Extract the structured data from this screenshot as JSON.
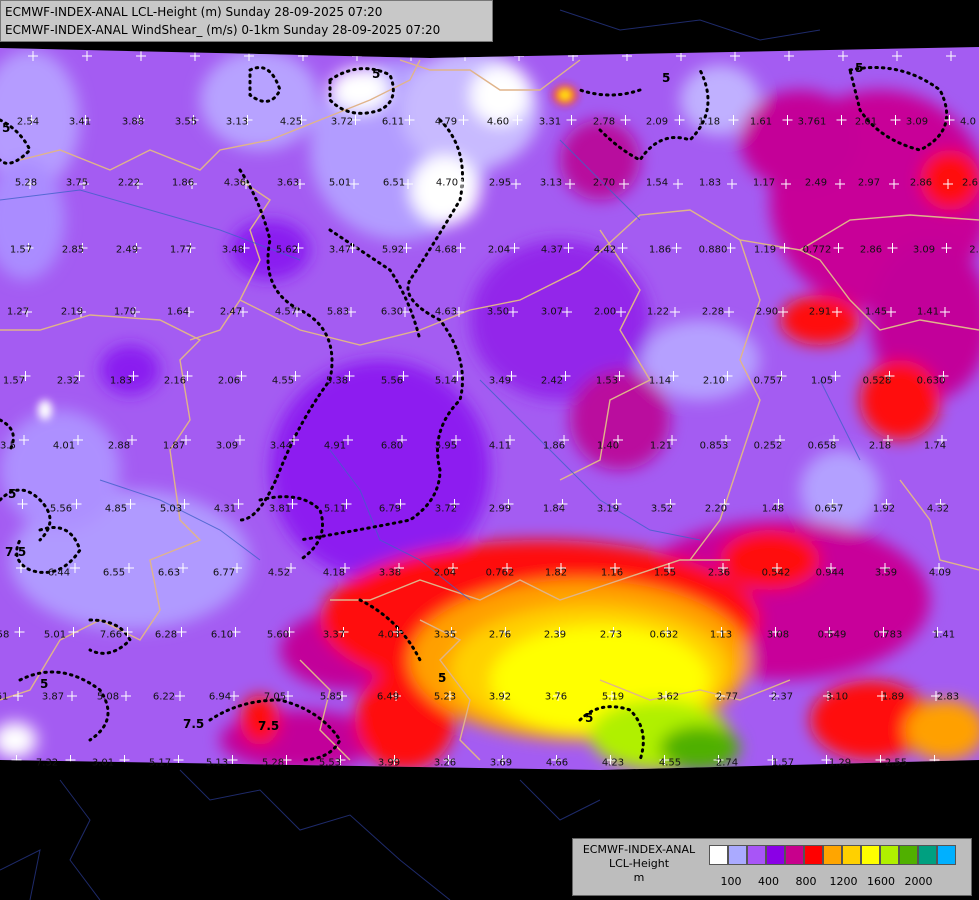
{
  "header": {
    "line1": "ECMWF-INDEX-ANAL LCL-Height (m) Sunday 28-09-2025 07:20",
    "line2": "ECMWF-INDEX-ANAL WindShear_ (m/s) 0-1km Sunday 28-09-2025 07:20"
  },
  "legend": {
    "title_line1": "ECMWF-INDEX-ANAL",
    "title_line2": "LCL-Height",
    "title_line3": "m",
    "colors": [
      "#ffffff",
      "#aaaaff",
      "#a855f7",
      "#8a00e6",
      "#c8008c",
      "#ff0000",
      "#ffa500",
      "#ffd000",
      "#ffff00",
      "#b0f000",
      "#50b000",
      "#00a080",
      "#00b0ff"
    ],
    "ticks": [
      "100",
      "400",
      "800",
      "1200",
      "1600",
      "2000"
    ]
  },
  "contour_labels": [
    "5",
    "5",
    "5",
    "5",
    "5",
    "7.5",
    "7.5",
    "7.5",
    "5",
    "5",
    "5"
  ],
  "values": [
    {
      "t": "2.54"
    },
    {
      "t": "3.41"
    },
    {
      "t": "3.88"
    },
    {
      "t": "3.55"
    },
    {
      "t": "3.13"
    },
    {
      "t": "4.25"
    },
    {
      "t": "3.72"
    },
    {
      "t": "6.11"
    },
    {
      "t": "4.79"
    },
    {
      "t": "4.60"
    },
    {
      "t": "3.31"
    },
    {
      "t": "2.78"
    },
    {
      "t": "2.09"
    },
    {
      "t": "1.18"
    },
    {
      "t": "1.61"
    },
    {
      "t": "3.761"
    },
    {
      "t": "2.61"
    },
    {
      "t": "3.09"
    },
    {
      "t": "4.0"
    },
    {
      "t": "5.28"
    },
    {
      "t": "3.75"
    },
    {
      "t": "2.22"
    },
    {
      "t": "1.86"
    },
    {
      "t": "4.36"
    },
    {
      "t": "3.63"
    },
    {
      "t": "5.01"
    },
    {
      "t": "6.51"
    },
    {
      "t": "4.70"
    },
    {
      "t": "2.95"
    },
    {
      "t": "3.13"
    },
    {
      "t": "2.70"
    },
    {
      "t": "1.54"
    },
    {
      "t": "1.83"
    },
    {
      "t": "1.17"
    },
    {
      "t": "2.49"
    },
    {
      "t": "2.97"
    },
    {
      "t": "2.86"
    },
    {
      "t": "2.6"
    },
    {
      "t": "1.57"
    },
    {
      "t": "2.85"
    },
    {
      "t": "2.49"
    },
    {
      "t": "1.77"
    },
    {
      "t": "3.48"
    },
    {
      "t": "5.62"
    },
    {
      "t": "3.47"
    },
    {
      "t": "5.92"
    },
    {
      "t": "4.68"
    },
    {
      "t": "2.04"
    },
    {
      "t": "4.37"
    },
    {
      "t": "4.42"
    },
    {
      "t": "1.86"
    },
    {
      "t": "0.880"
    },
    {
      "t": "1.19"
    },
    {
      "t": "0.772"
    },
    {
      "t": "2.86"
    },
    {
      "t": "3.09"
    },
    {
      "t": "2."
    },
    {
      "t": "1.27"
    },
    {
      "t": "2.19"
    },
    {
      "t": "1.70"
    },
    {
      "t": "1.64"
    },
    {
      "t": "2.47"
    },
    {
      "t": "4.57"
    },
    {
      "t": "5.83"
    },
    {
      "t": "6.30"
    },
    {
      "t": "4.63"
    },
    {
      "t": "3.50"
    },
    {
      "t": "3.07"
    },
    {
      "t": "2.00"
    },
    {
      "t": "1.22"
    },
    {
      "t": "2.28"
    },
    {
      "t": "2.90"
    },
    {
      "t": "2.91"
    },
    {
      "t": "1.45"
    },
    {
      "t": "1.41"
    },
    {
      "t": "1.57"
    },
    {
      "t": "2.32"
    },
    {
      "t": "1.83"
    },
    {
      "t": "2.16"
    },
    {
      "t": "2.06"
    },
    {
      "t": "4.55"
    },
    {
      "t": "5.38"
    },
    {
      "t": "5.56"
    },
    {
      "t": "5.14"
    },
    {
      "t": "3.49"
    },
    {
      "t": "2.42"
    },
    {
      "t": "1.53"
    },
    {
      "t": "1.14"
    },
    {
      "t": "2.10"
    },
    {
      "t": "0.757"
    },
    {
      "t": "1.05"
    },
    {
      "t": "0.528"
    },
    {
      "t": "0.630"
    },
    {
      "t": "3.5"
    },
    {
      "t": "4.01"
    },
    {
      "t": "2.88"
    },
    {
      "t": "1.87"
    },
    {
      "t": "3.09"
    },
    {
      "t": "3.44"
    },
    {
      "t": "4.91"
    },
    {
      "t": "6.80"
    },
    {
      "t": "5.95"
    },
    {
      "t": "4.11"
    },
    {
      "t": "1.86"
    },
    {
      "t": "1.40"
    },
    {
      "t": "1.21"
    },
    {
      "t": "0.853"
    },
    {
      "t": "0.252"
    },
    {
      "t": "0.658"
    },
    {
      "t": "2.18"
    },
    {
      "t": "1.74"
    },
    {
      "t": "5.56"
    },
    {
      "t": "4.85"
    },
    {
      "t": "5.03"
    },
    {
      "t": "4.31"
    },
    {
      "t": "3.81"
    },
    {
      "t": "5.11"
    },
    {
      "t": "6.79"
    },
    {
      "t": "3.72"
    },
    {
      "t": "2.99"
    },
    {
      "t": "1.84"
    },
    {
      "t": "3.19"
    },
    {
      "t": "3.52"
    },
    {
      "t": "2.20"
    },
    {
      "t": "1.48"
    },
    {
      "t": "0.657"
    },
    {
      "t": "1.92"
    },
    {
      "t": "4.32"
    },
    {
      "t": "6.44"
    },
    {
      "t": "6.55"
    },
    {
      "t": "6.63"
    },
    {
      "t": "6.77"
    },
    {
      "t": "4.52"
    },
    {
      "t": "4.18"
    },
    {
      "t": "3.38"
    },
    {
      "t": "2.04"
    },
    {
      "t": "0.762"
    },
    {
      "t": "1.82"
    },
    {
      "t": "1.16"
    },
    {
      "t": "1.55"
    },
    {
      "t": "2.36"
    },
    {
      "t": "0.542"
    },
    {
      "t": "0.944"
    },
    {
      "t": "3.59"
    },
    {
      "t": "4.09"
    },
    {
      "t": "58"
    },
    {
      "t": "5.01"
    },
    {
      "t": "7.66"
    },
    {
      "t": "6.28"
    },
    {
      "t": "6.10"
    },
    {
      "t": "5.60"
    },
    {
      "t": "3.37"
    },
    {
      "t": "4.03"
    },
    {
      "t": "3.35"
    },
    {
      "t": "2.76"
    },
    {
      "t": "2.39"
    },
    {
      "t": "2.73"
    },
    {
      "t": "0.632"
    },
    {
      "t": "1.13"
    },
    {
      "t": "3.08"
    },
    {
      "t": "0.549"
    },
    {
      "t": "0.783"
    },
    {
      "t": "1.41"
    },
    {
      "t": "61"
    },
    {
      "t": "3.87"
    },
    {
      "t": "5.08"
    },
    {
      "t": "6.22"
    },
    {
      "t": "6.94"
    },
    {
      "t": "7.05"
    },
    {
      "t": "5.85"
    },
    {
      "t": "6.49"
    },
    {
      "t": "5.23"
    },
    {
      "t": "3.92"
    },
    {
      "t": "3.76"
    },
    {
      "t": "5.19"
    },
    {
      "t": "3.62"
    },
    {
      "t": "2.77"
    },
    {
      "t": "2.37"
    },
    {
      "t": "3.10"
    },
    {
      "t": "1.89"
    },
    {
      "t": "2.83"
    },
    {
      "t": "7.32"
    },
    {
      "t": "3.01"
    },
    {
      "t": "5.17"
    },
    {
      "t": "5.13"
    },
    {
      "t": "5.28"
    },
    {
      "t": "5.53"
    },
    {
      "t": "3.99"
    },
    {
      "t": "3.26"
    },
    {
      "t": "3.69"
    },
    {
      "t": "4.66"
    },
    {
      "t": "4.23"
    },
    {
      "t": "4.55"
    },
    {
      "t": "2.74"
    },
    {
      "t": "1.57"
    },
    {
      "t": "1.29"
    },
    {
      "t": "2.55"
    }
  ]
}
